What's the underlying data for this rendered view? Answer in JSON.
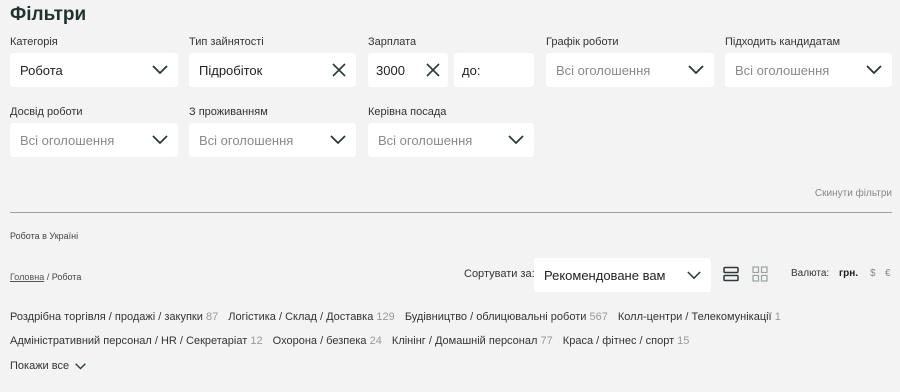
{
  "title": "Фільтри",
  "filters": {
    "category": {
      "label": "Категорія",
      "value": "Робота"
    },
    "employment": {
      "label": "Тип зайнятості",
      "value": "Підробіток"
    },
    "salary": {
      "label": "Зарплата",
      "from": "3000",
      "to_placeholder": "до:"
    },
    "schedule": {
      "label": "Графік роботи",
      "placeholder": "Всі оголошення"
    },
    "suits": {
      "label": "Підходить кандидатам",
      "placeholder": "Всі оголошення"
    },
    "experience": {
      "label": "Досвід роботи",
      "placeholder": "Всі оголошення"
    },
    "housing": {
      "label": "З проживанням",
      "placeholder": "Всі оголошення"
    },
    "management": {
      "label": "Керівна посада",
      "placeholder": "Всі оголошення"
    },
    "reset": "Скинути фільтри"
  },
  "location_title": "Робота в Україні",
  "breadcrumb": {
    "home": "Головна",
    "sep": " / ",
    "current": "Робота"
  },
  "sort": {
    "label": "Сортувати за:",
    "value": "Рекомендоване вам"
  },
  "currency": {
    "label": "Валюта:",
    "options": [
      "грн.",
      "$",
      "€"
    ],
    "active": "грн."
  },
  "categories_row1": [
    {
      "name": "Роздрібна торгівля / продажі / закупки",
      "count": "87"
    },
    {
      "name": "Логістика / Склад / Доставка",
      "count": "129"
    },
    {
      "name": "Будівництво / облицювальні роботи",
      "count": "567"
    },
    {
      "name": "Колл-центри / Телекомунікації",
      "count": "1"
    }
  ],
  "categories_row2": [
    {
      "name": "Адміністративний персонал / HR / Секретаріат",
      "count": "12"
    },
    {
      "name": "Охорона / безпека",
      "count": "24"
    },
    {
      "name": "Клінінг / Домашній персонал",
      "count": "77"
    },
    {
      "name": "Краса / фітнес / спорт",
      "count": "15"
    }
  ],
  "show_all": "Покажи все",
  "colors": {
    "accent": "#2b3a37",
    "background": "#f3f3f3"
  }
}
